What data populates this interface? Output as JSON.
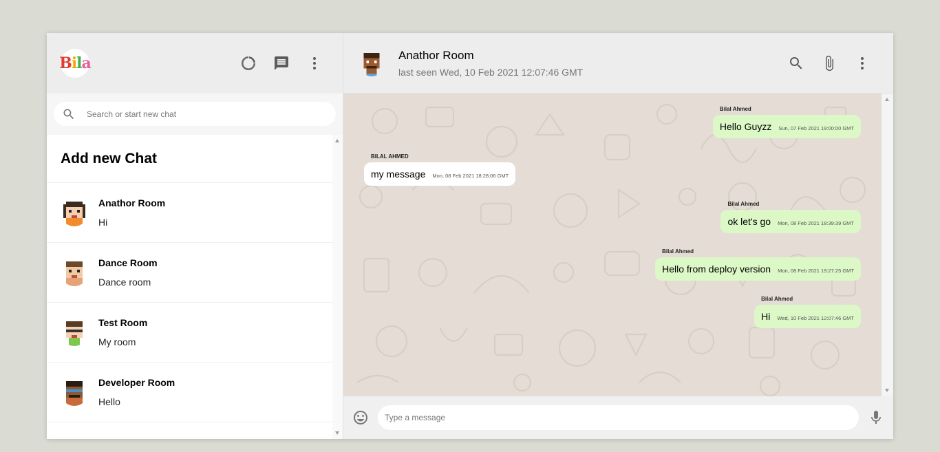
{
  "sidebar": {
    "logo": [
      "B",
      "i",
      "l",
      "a"
    ],
    "icons": [
      "status-icon",
      "new-chat-icon",
      "more-vert-icon"
    ],
    "search": {
      "placeholder": "Search or start new chat",
      "value": ""
    },
    "add_chat_label": "Add new Chat",
    "chats": [
      {
        "name": "Anathor Room",
        "last": "Hi"
      },
      {
        "name": "Dance Room",
        "last": "Dance room"
      },
      {
        "name": "Test Room",
        "last": "My room"
      },
      {
        "name": "Developer Room",
        "last": "Hello"
      }
    ]
  },
  "chat": {
    "header": {
      "room_name": "Anathor Room",
      "last_seen": "last seen Wed, 10 Feb 2021 12:07:46 GMT"
    },
    "messages": [
      {
        "sender": "Bilal Ahmed",
        "text": "Hello Guyzz",
        "time": "Sun, 07 Feb 2021 19:00:00 GMT",
        "mine": true
      },
      {
        "sender": "BILAL AHMED",
        "text": "my message",
        "time": "Mon, 08 Feb 2021 18:28:06 GMT",
        "mine": false
      },
      {
        "sender": "Bilal Ahmed",
        "text": "ok let's go",
        "time": "Mon, 08 Feb 2021 18:39:39 GMT",
        "mine": true
      },
      {
        "sender": "Bilal Ahmed",
        "text": "Hello from deploy version",
        "time": "Mon, 08 Feb 2021 19:27:25 GMT",
        "mine": true
      },
      {
        "sender": "Bilal Ahmed",
        "text": "Hi",
        "time": "Wed, 10 Feb 2021 12:07:46 GMT",
        "mine": true
      }
    ],
    "footer": {
      "placeholder": "Type a message",
      "value": ""
    }
  },
  "colors": {
    "background": "#dadbd3",
    "header": "#ededed",
    "chat_background": "#e5ddd5",
    "own_bubble": "#dcf8c6",
    "other_bubble": "#ffffff"
  }
}
